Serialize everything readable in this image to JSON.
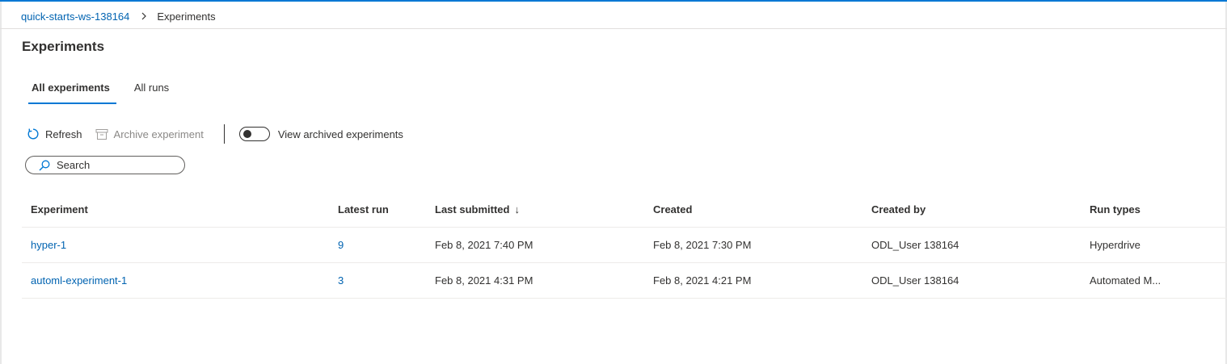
{
  "breadcrumb": {
    "workspace": "quick-starts-ws-138164",
    "current": "Experiments"
  },
  "page": {
    "title": "Experiments"
  },
  "tabs": [
    {
      "label": "All experiments",
      "active": true
    },
    {
      "label": "All runs",
      "active": false
    }
  ],
  "toolbar": {
    "refresh_label": "Refresh",
    "archive_label": "Archive experiment",
    "view_archived_label": "View archived experiments",
    "view_archived_on": false
  },
  "search": {
    "placeholder": "Search"
  },
  "table": {
    "columns": [
      "Experiment",
      "Latest run",
      "Last submitted",
      "Created",
      "Created by",
      "Run types"
    ],
    "sort_arrow": "↓",
    "rows": [
      {
        "experiment": "hyper-1",
        "latest_run": "9",
        "last_submitted": "Feb 8, 2021 7:40 PM",
        "created": "Feb 8, 2021 7:30 PM",
        "created_by": "ODL_User 138164",
        "run_types": "Hyperdrive"
      },
      {
        "experiment": "automl-experiment-1",
        "latest_run": "3",
        "last_submitted": "Feb 8, 2021 4:31 PM",
        "created": "Feb 8, 2021 4:21 PM",
        "created_by": "ODL_User 138164",
        "run_types": "Automated M..."
      }
    ]
  },
  "colors": {
    "accent": "#0078d4",
    "link": "#0063b1",
    "text": "#323130",
    "disabled": "#8a8886"
  }
}
